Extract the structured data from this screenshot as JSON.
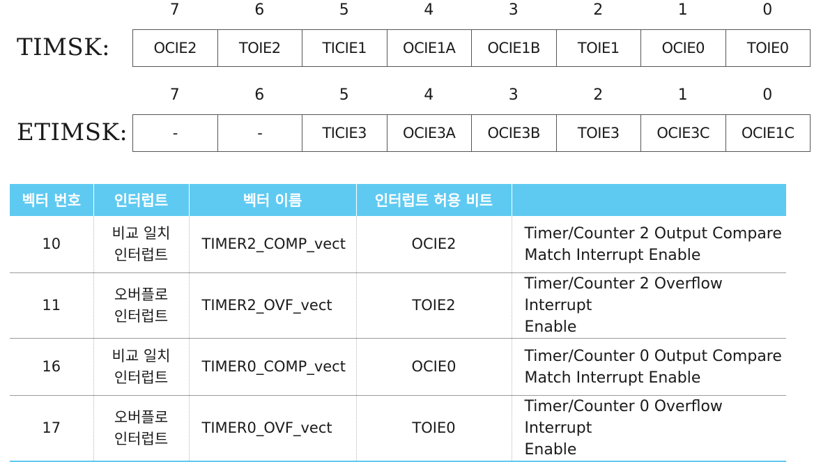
{
  "registers": [
    {
      "name": "TIMSK:",
      "bit_numbers": [
        "7",
        "6",
        "5",
        "4",
        "3",
        "2",
        "1",
        "0"
      ],
      "bits": [
        "OCIE2",
        "TOIE2",
        "TICIE1",
        "OCIE1A",
        "OCIE1B",
        "TOIE1",
        "OCIE0",
        "TOIE0"
      ]
    },
    {
      "name": "ETIMSK:",
      "bit_numbers": [
        "7",
        "6",
        "5",
        "4",
        "3",
        "2",
        "1",
        "0"
      ],
      "bits": [
        "-",
        "-",
        "TICIE3",
        "OCIE3A",
        "OCIE3B",
        "TOIE3",
        "OCIE3C",
        "OCIE1C"
      ]
    }
  ],
  "table": {
    "headers": [
      "벡터 번호",
      "인터럽트",
      "벡터 이름",
      "인터럽트 허용 비트",
      ""
    ],
    "rows": [
      {
        "num": "10",
        "kind": [
          "비교 일치",
          "인터럽트"
        ],
        "vector": "TIMER2_COMP_vect",
        "bit": "OCIE2",
        "desc": [
          "Timer/Counter 2 Output Compare",
          "Match Interrupt Enable"
        ]
      },
      {
        "num": "11",
        "kind": [
          "오버플로",
          "인터럽트"
        ],
        "vector": "TIMER2_OVF_vect",
        "bit": "TOIE2",
        "desc": [
          "Timer/Counter 2 Overflow Interrupt",
          "Enable"
        ]
      },
      {
        "num": "16",
        "kind": [
          "비교 일치",
          "인터럽트"
        ],
        "vector": "TIMER0_COMP_vect",
        "bit": "OCIE0",
        "desc": [
          "Timer/Counter 0 Output Compare",
          "Match Interrupt Enable"
        ]
      },
      {
        "num": "17",
        "kind": [
          "오버플로",
          "인터럽트"
        ],
        "vector": "TIMER0_OVF_vect",
        "bit": "TOIE0",
        "desc": [
          "Timer/Counter 0 Overflow Interrupt",
          "Enable"
        ]
      }
    ]
  },
  "colors": {
    "header_bg": "#5fcaf1",
    "header_text": "#ffffff"
  }
}
